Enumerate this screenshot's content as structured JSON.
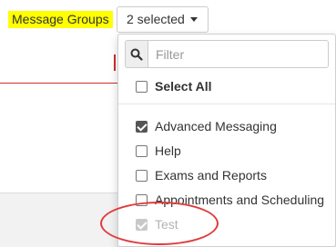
{
  "field": {
    "label": "Message Groups"
  },
  "dropdown": {
    "toggle_label": "2 selected"
  },
  "menu": {
    "filter_placeholder": "Filter",
    "select_all": {
      "label": "Select All",
      "checked": false
    },
    "items": [
      {
        "label": "Advanced Messaging",
        "checked": true,
        "disabled": false
      },
      {
        "label": "Help",
        "checked": false,
        "disabled": false
      },
      {
        "label": "Exams and Reports",
        "checked": false,
        "disabled": false
      },
      {
        "label": "Appointments and Scheduling",
        "checked": false,
        "disabled": false
      },
      {
        "label": "Test",
        "checked": true,
        "disabled": true
      }
    ]
  },
  "colors": {
    "highlight": "#ffff00",
    "annotation": "#e03b3b"
  },
  "icons": {
    "search": "search-icon",
    "caret": "caret-down-icon"
  }
}
